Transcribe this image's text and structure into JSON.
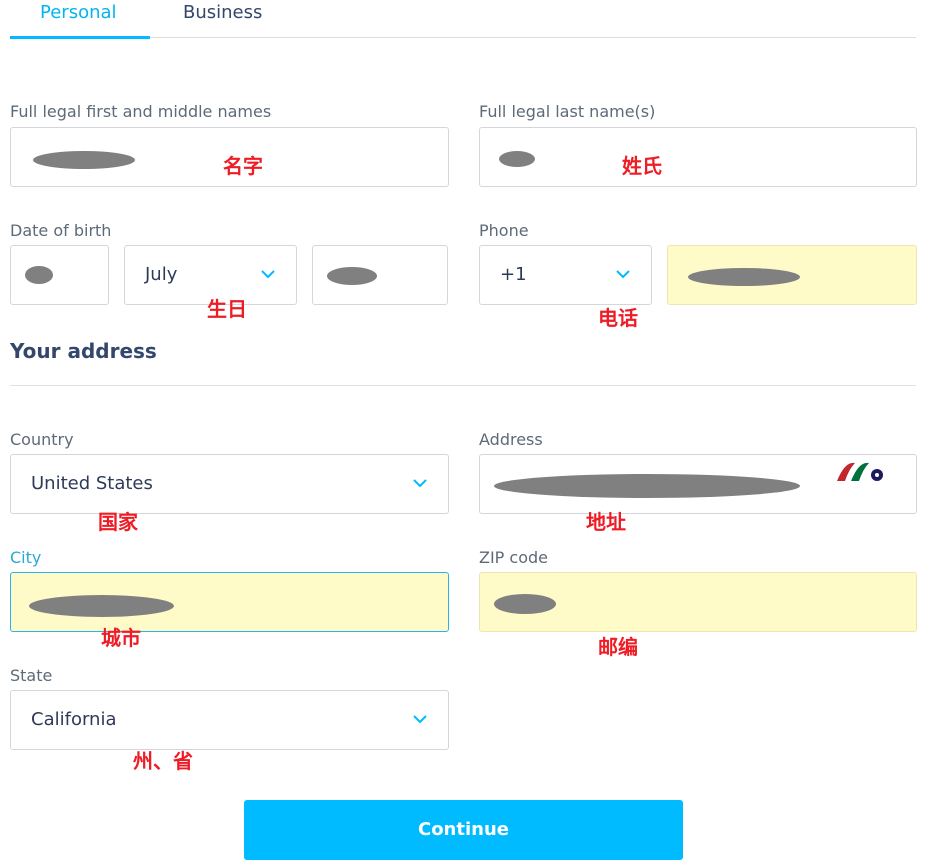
{
  "tabs": [
    {
      "label": "Personal",
      "active": true
    },
    {
      "label": "Business",
      "active": false
    }
  ],
  "fields": {
    "first_name": {
      "label": "Full legal first and middle names",
      "note": "名字"
    },
    "last_name": {
      "label": "Full legal last name(s)",
      "note": "姓氏"
    },
    "dob": {
      "label": "Date of birth",
      "month": "July",
      "note": "生日"
    },
    "phone": {
      "label": "Phone",
      "code": "+1",
      "note": "电话"
    },
    "country": {
      "label": "Country",
      "value": "United States",
      "note": "国家"
    },
    "address": {
      "label": "Address",
      "note": "地址"
    },
    "city": {
      "label": "City",
      "note": "城市"
    },
    "zip": {
      "label": "ZIP code",
      "note": "邮编"
    },
    "state": {
      "label": "State",
      "value": "California",
      "note": "州、省"
    }
  },
  "section_title": "Your address",
  "continue_label": "Continue",
  "colors": {
    "accent": "#00bbff",
    "autofill": "#fffbc8",
    "note": "#ee1c25",
    "heading": "#34476b"
  }
}
